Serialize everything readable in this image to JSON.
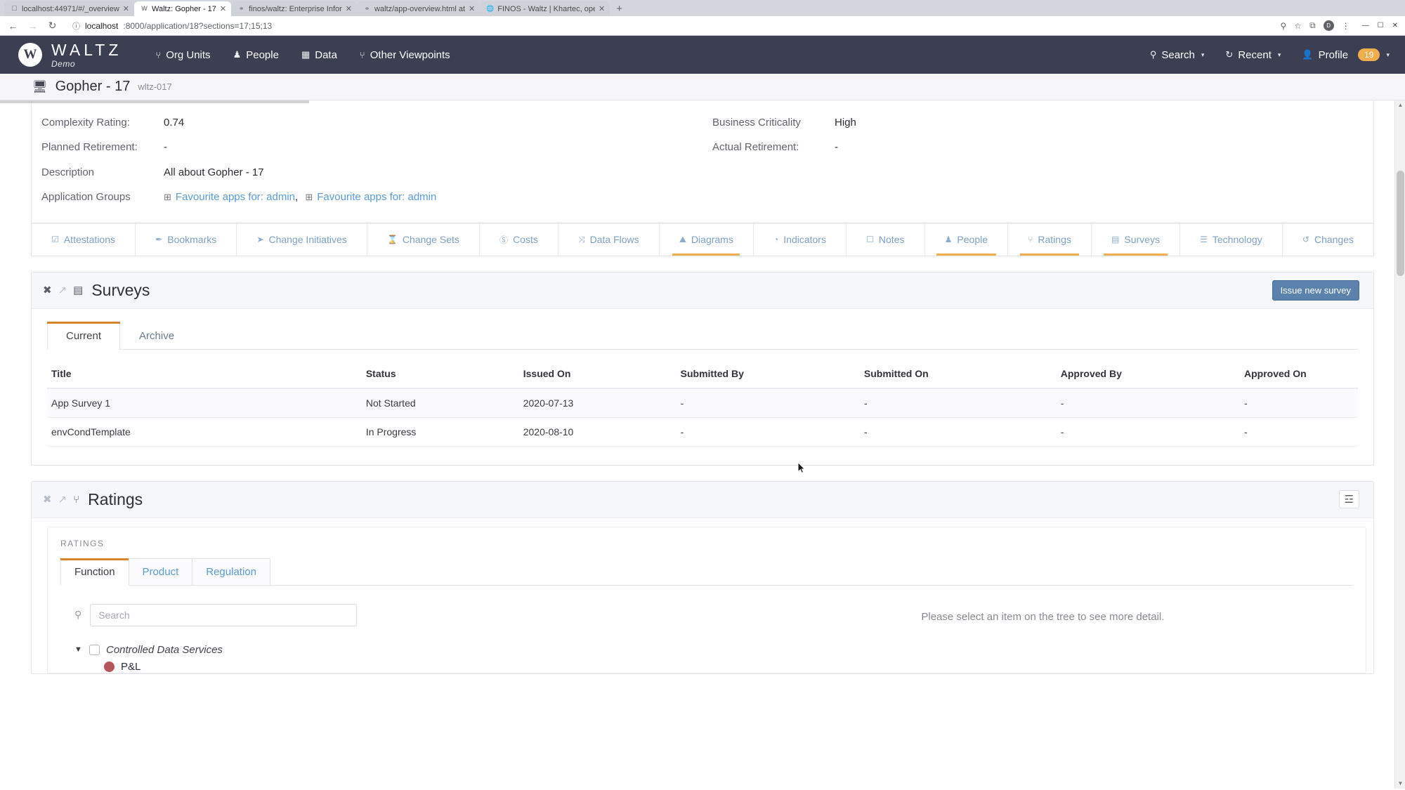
{
  "browser": {
    "tabs": [
      {
        "title": "localhost:44971/#/_overview",
        "favicon": "page-icon",
        "active": false
      },
      {
        "title": "Waltz: Gopher - 17",
        "favicon": "waltz-icon",
        "active": true
      },
      {
        "title": "finos/waltz: Enterprise Infor",
        "favicon": "github-icon",
        "active": false
      },
      {
        "title": "waltz/app-overview.html at",
        "favicon": "github-icon",
        "active": false
      },
      {
        "title": "FINOS - Waltz | Khartec, ope",
        "favicon": "globe-icon",
        "active": false
      }
    ],
    "new_tab_label": "+",
    "close_label": "✕",
    "url_host": "localhost",
    "url_rest": ":8000/application/18?sections=17;15;13",
    "back_label": "←",
    "forward_label": "→",
    "reload_label": "↻",
    "info_label": "ⓘ",
    "star_label": "☆",
    "ext_label": "⧉",
    "menu_label": "⋮",
    "profile_initial": "D",
    "window_min": "—",
    "window_max": "☐",
    "window_close": "✕"
  },
  "navbar": {
    "brand_name": "WALTZ",
    "brand_sub": "Demo",
    "brand_glyph": "W",
    "items": [
      {
        "label": "Org Units",
        "icon": "org-units-icon",
        "glyph": "⑂"
      },
      {
        "label": "People",
        "icon": "people-icon",
        "glyph": "♟"
      },
      {
        "label": "Data",
        "icon": "data-icon",
        "glyph": "▦"
      },
      {
        "label": "Other Viewpoints",
        "icon": "viewpoints-icon",
        "glyph": "⑂"
      }
    ],
    "right": {
      "search_label": "Search",
      "search_icon": "search-icon",
      "recent_label": "Recent",
      "recent_icon": "history-icon",
      "profile_label": "Profile",
      "profile_icon": "user-icon",
      "profile_badge": "19",
      "caret": "▾"
    }
  },
  "entity_header": {
    "icon": "desktop-icon",
    "name": "Gopher - 17",
    "external_id": "wltz-017"
  },
  "details": [
    [
      {
        "label": "Complexity Rating:",
        "value": "0.74",
        "name": "complexity-rating"
      },
      {
        "label": "Business Criticality",
        "value": "High",
        "name": "business-criticality"
      }
    ],
    [
      {
        "label": "Planned Retirement:",
        "value": "-",
        "name": "planned-retirement"
      },
      {
        "label": "Actual Retirement:",
        "value": "-",
        "name": "actual-retirement"
      }
    ],
    [
      {
        "label": "Description",
        "value": "All about Gopher - 17",
        "name": "description"
      }
    ]
  ],
  "app_groups": {
    "label": "Application Groups",
    "items": [
      "Favourite apps for: admin",
      "Favourite apps for: admin"
    ],
    "separator": ",",
    "icon": "group-icon",
    "icon_glyph": "⊞"
  },
  "section_tabs": [
    {
      "label": "Attestations",
      "glyph": "☑",
      "active": false
    },
    {
      "label": "Bookmarks",
      "glyph": "✒",
      "active": false
    },
    {
      "label": "Change Initiatives",
      "glyph": "➤",
      "active": false
    },
    {
      "label": "Change Sets",
      "glyph": "⌛",
      "active": false
    },
    {
      "label": "Costs",
      "glyph": "Ⓢ",
      "active": false
    },
    {
      "label": "Data Flows",
      "glyph": "⤨",
      "active": false
    },
    {
      "label": "Diagrams",
      "glyph": "⛰",
      "active": true
    },
    {
      "label": "Indicators",
      "glyph": "◔",
      "active": false
    },
    {
      "label": "Notes",
      "glyph": "☐",
      "active": false
    },
    {
      "label": "People",
      "glyph": "♟",
      "active": true
    },
    {
      "label": "Ratings",
      "glyph": "⑂",
      "active": true
    },
    {
      "label": "Surveys",
      "glyph": "▤",
      "active": true
    },
    {
      "label": "Technology",
      "glyph": "☰",
      "active": false
    },
    {
      "label": "Changes",
      "glyph": "↺",
      "active": false
    }
  ],
  "surveys_panel": {
    "title": "Surveys",
    "close_glyph": "✖",
    "external_glyph": "↗",
    "section_glyph": "▤",
    "button_label": "Issue new survey",
    "tabs": [
      {
        "label": "Current",
        "active": true
      },
      {
        "label": "Archive",
        "active": false
      }
    ],
    "columns": [
      "Title",
      "Status",
      "Issued On",
      "Submitted By",
      "Submitted On",
      "Approved By",
      "Approved On"
    ],
    "rows": [
      {
        "title": "App Survey 1",
        "status": "Not Started",
        "issued_on": "2020-07-13",
        "submitted_by": "-",
        "submitted_on": "-",
        "approved_by": "-",
        "approved_on": "-"
      },
      {
        "title": "envCondTemplate",
        "status": "In Progress",
        "issued_on": "2020-08-10",
        "submitted_by": "-",
        "submitted_on": "-",
        "approved_by": "-",
        "approved_on": "-"
      }
    ]
  },
  "ratings_panel": {
    "title": "Ratings",
    "close_glyph": "✖",
    "external_glyph": "↗",
    "section_glyph": "⑂",
    "options_glyph": "☲",
    "caption": "RATINGS",
    "tabs": [
      {
        "label": "Function",
        "active": true
      },
      {
        "label": "Product",
        "active": false
      },
      {
        "label": "Regulation",
        "active": false
      }
    ],
    "search_placeholder": "Search",
    "search_value": "",
    "search_icon": "search-icon",
    "tree": {
      "caret": "▼",
      "root_label": "Controlled Data Services",
      "children": [
        {
          "label": "P&L",
          "color": "#b4565c"
        }
      ]
    },
    "empty_detail": "Please select an item on the tree to see more detail."
  },
  "colors": {
    "nav_bg": "#3b3f51",
    "accent_orange": "#f0ad4e",
    "tab_underline": "#d9832b",
    "link_blue": "#5b9bd5",
    "button_blue": "#5a82ad"
  }
}
